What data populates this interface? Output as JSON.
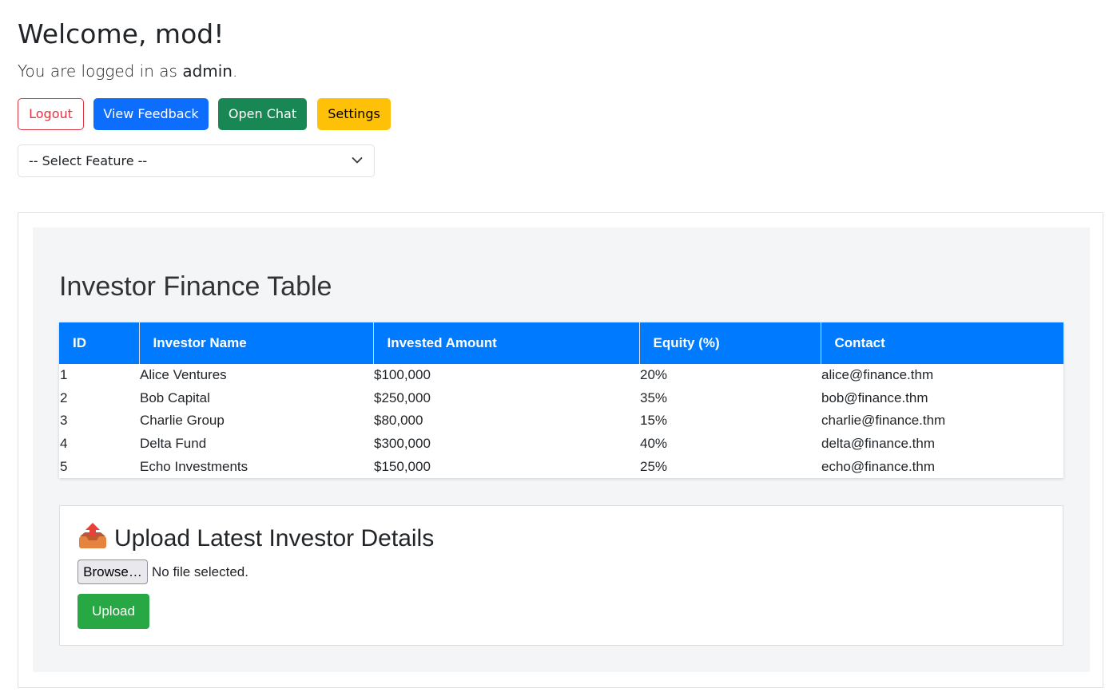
{
  "header": {
    "welcome": "Welcome, mod!",
    "logged_prefix": "You are logged in as ",
    "logged_user": "admin",
    "logged_suffix": "."
  },
  "actions": {
    "logout": "Logout",
    "view_feedback": "View Feedback",
    "open_chat": "Open Chat",
    "settings": "Settings"
  },
  "feature_select": {
    "selected": "-- Select Feature --"
  },
  "finance": {
    "title": "Investor Finance Table",
    "columns": [
      "ID",
      "Investor Name",
      "Invested Amount",
      "Equity (%)",
      "Contact"
    ],
    "rows": [
      [
        "1",
        "Alice Ventures",
        "$100,000",
        "20%",
        "alice@finance.thm"
      ],
      [
        "2",
        "Bob Capital",
        "$250,000",
        "35%",
        "bob@finance.thm"
      ],
      [
        "3",
        "Charlie Group",
        "$80,000",
        "15%",
        "charlie@finance.thm"
      ],
      [
        "4",
        "Delta Fund",
        "$300,000",
        "40%",
        "delta@finance.thm"
      ],
      [
        "5",
        "Echo Investments",
        "$150,000",
        "25%",
        "echo@finance.thm"
      ]
    ]
  },
  "upload": {
    "icon": "outbox-tray-icon",
    "title": "Upload Latest Investor Details",
    "browse_label": "Browse…",
    "file_status": "No file selected.",
    "submit_label": "Upload"
  },
  "colors": {
    "primary": "#0d6efd",
    "success": "#198754",
    "warning": "#ffc107",
    "danger": "#dc3545",
    "table_header": "#007bff",
    "upload_button": "#28a745"
  }
}
